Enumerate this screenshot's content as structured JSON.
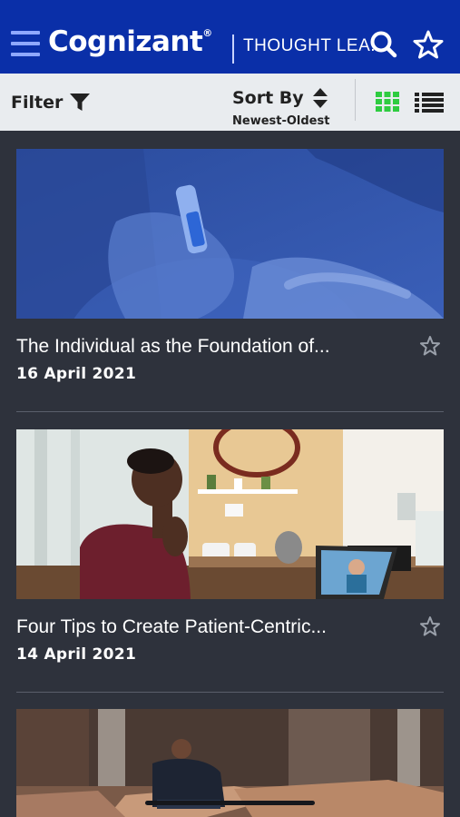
{
  "header": {
    "logo": "Cognizant",
    "logo_mark": "®",
    "section": "THOUGHT LEA..."
  },
  "toolbar": {
    "filter_label": "Filter",
    "sort_label": "Sort By",
    "sort_value": "Newest-Oldest",
    "view_mode": "grid",
    "accent": "#2ecc40"
  },
  "articles": [
    {
      "title": "The Individual as the Foundation of...",
      "date": "16 April 2021",
      "image": "hands-test-photo-blue"
    },
    {
      "title": "Four Tips to Create Patient-Centric...",
      "date": "14 April 2021",
      "image": "woman-video-call-kitchen"
    },
    {
      "title": "",
      "date": "",
      "image": "man-warehouse-rugs"
    }
  ],
  "colors": {
    "header_bg": "#0a2fa8",
    "toolbar_bg": "#e9ecef",
    "page_bg": "#2e323c"
  }
}
